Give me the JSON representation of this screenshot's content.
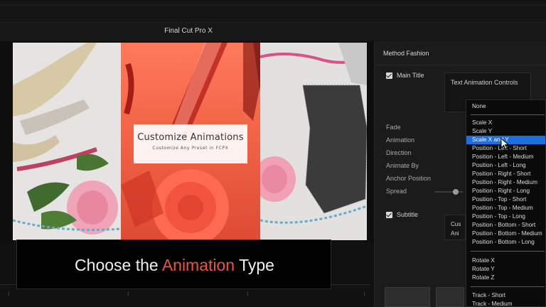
{
  "app": {
    "title": "Final Cut Pro X"
  },
  "viewer": {
    "card_title": "Customize Animations",
    "card_subtitle": "Customize Any Preset in FCPX"
  },
  "caption": {
    "prefix": "Choose the ",
    "accent": "Animation",
    "suffix": " Type",
    "accent_color": "#e8573c"
  },
  "inspector": {
    "header": "Method Fashion",
    "main_title_label": "Main Title",
    "text_animation_controls": "Text Animation Controls",
    "params": [
      "Fade",
      "Animation",
      "Direction",
      "Animate By",
      "Anchor Position",
      "Spread"
    ],
    "subtitle_label": "Subtitle",
    "subtitle_box": [
      "Cus",
      "Ani"
    ]
  },
  "dropdown": {
    "selected": "Scale X and Y",
    "selected_color": "#1d6fe0",
    "groups": [
      [
        "None"
      ],
      [
        "Scale X",
        "Scale Y",
        "Scale X and Y",
        "Position - Left - Short",
        "Position - Left - Medium",
        "Position - Left - Long",
        "Position - Right - Short",
        "Position - Right - Medium",
        "Position - Right - Long",
        "Position - Top - Short",
        "Position - Top - Medium",
        "Position - Top - Long",
        "Position - Bottom - Short",
        "Position - Bottom - Medium",
        "Position - Bottom - Long"
      ],
      [
        "Rotate X",
        "Rotate Y",
        "Rotate Z"
      ],
      [
        "Track - Short",
        "Track - Medium"
      ]
    ]
  }
}
